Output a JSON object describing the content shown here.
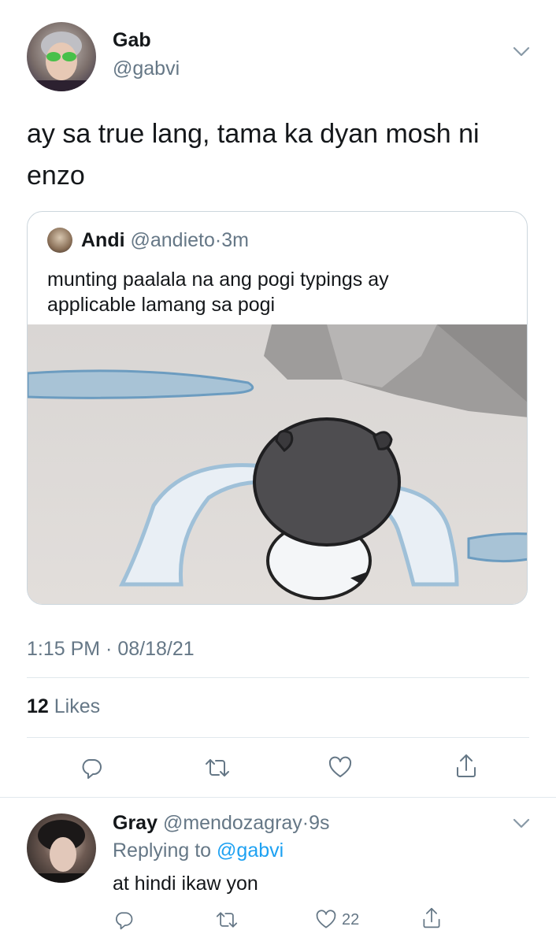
{
  "tweet": {
    "author_name": "Gab",
    "author_handle": "@gabvi",
    "text": "ay sa true lang, tama ka dyan mosh ni enzo",
    "timestamp": "1:15 PM · 08/18/21",
    "likes_count": "12",
    "likes_label": "Likes"
  },
  "quoted": {
    "author_name": "Andi",
    "author_handle": "@andieto",
    "separator": "·",
    "time": "3m",
    "text": "munting paalala na ang pogi typings ay applicable lamang sa pogi"
  },
  "reply": {
    "author_name": "Gray",
    "author_handle": "@mendozagray",
    "separator": "·",
    "time": "9s",
    "replying_prefix": "Replying to",
    "replying_handle": "@gabvi",
    "text": "at hindi ikaw yon",
    "like_count": "22"
  },
  "icons": {
    "caret": "chevron-down-icon",
    "reply": "reply-icon",
    "retweet": "retweet-icon",
    "like": "heart-icon",
    "share": "share-icon"
  },
  "colors": {
    "text": "#14171a",
    "secondary": "#657786",
    "link": "#1da1f2",
    "divider": "#e1e8ed"
  }
}
